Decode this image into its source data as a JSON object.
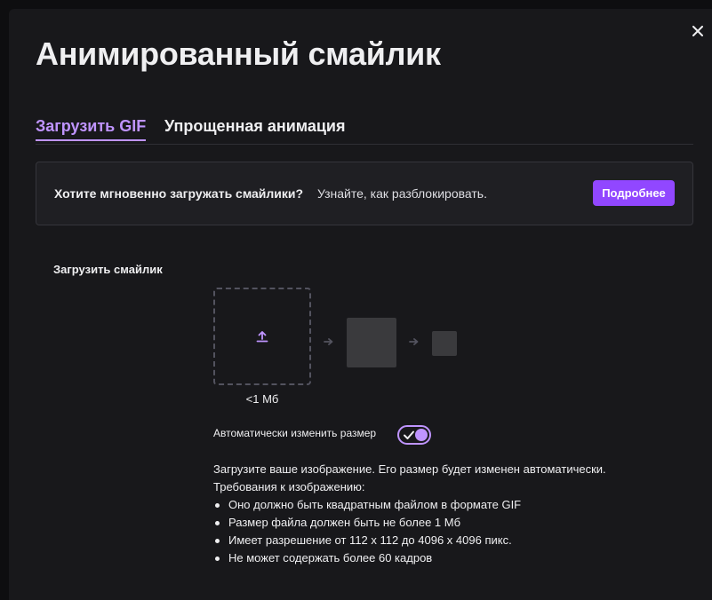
{
  "dialog": {
    "title": "Анимированный смайлик"
  },
  "tabs": [
    {
      "label": "Загрузить GIF",
      "active": true
    },
    {
      "label": "Упрощенная анимация",
      "active": false
    }
  ],
  "banner": {
    "question": "Хотите мгновенно загружать смайлики?",
    "hint": "Узнайте, как разблокировать.",
    "button_label": "Подробнее"
  },
  "upload": {
    "section_label": "Загрузить смайлик",
    "size_limit": "<1 Мб",
    "auto_resize_label": "Автоматически изменить размер",
    "auto_resize_on": true
  },
  "requirements": {
    "intro": "Загрузите ваше изображение. Его размер будет изменен автоматически.",
    "heading": "Требования к изображению:",
    "items": [
      "Оно должно быть квадратным файлом в формате GIF",
      "Размер файла должен быть не более 1 Мб",
      "Имеет разрешение от 112 x 112 до 4096 x 4096 пикс.",
      "Не может содержать более 60 кадров"
    ]
  },
  "colors": {
    "accent": "#9147ff",
    "accent_light": "#bf94ff",
    "background": "#18181b",
    "text": "#efeff1"
  },
  "icons": [
    "close-icon",
    "upload-icon",
    "arrow-right-icon",
    "check-icon"
  ]
}
